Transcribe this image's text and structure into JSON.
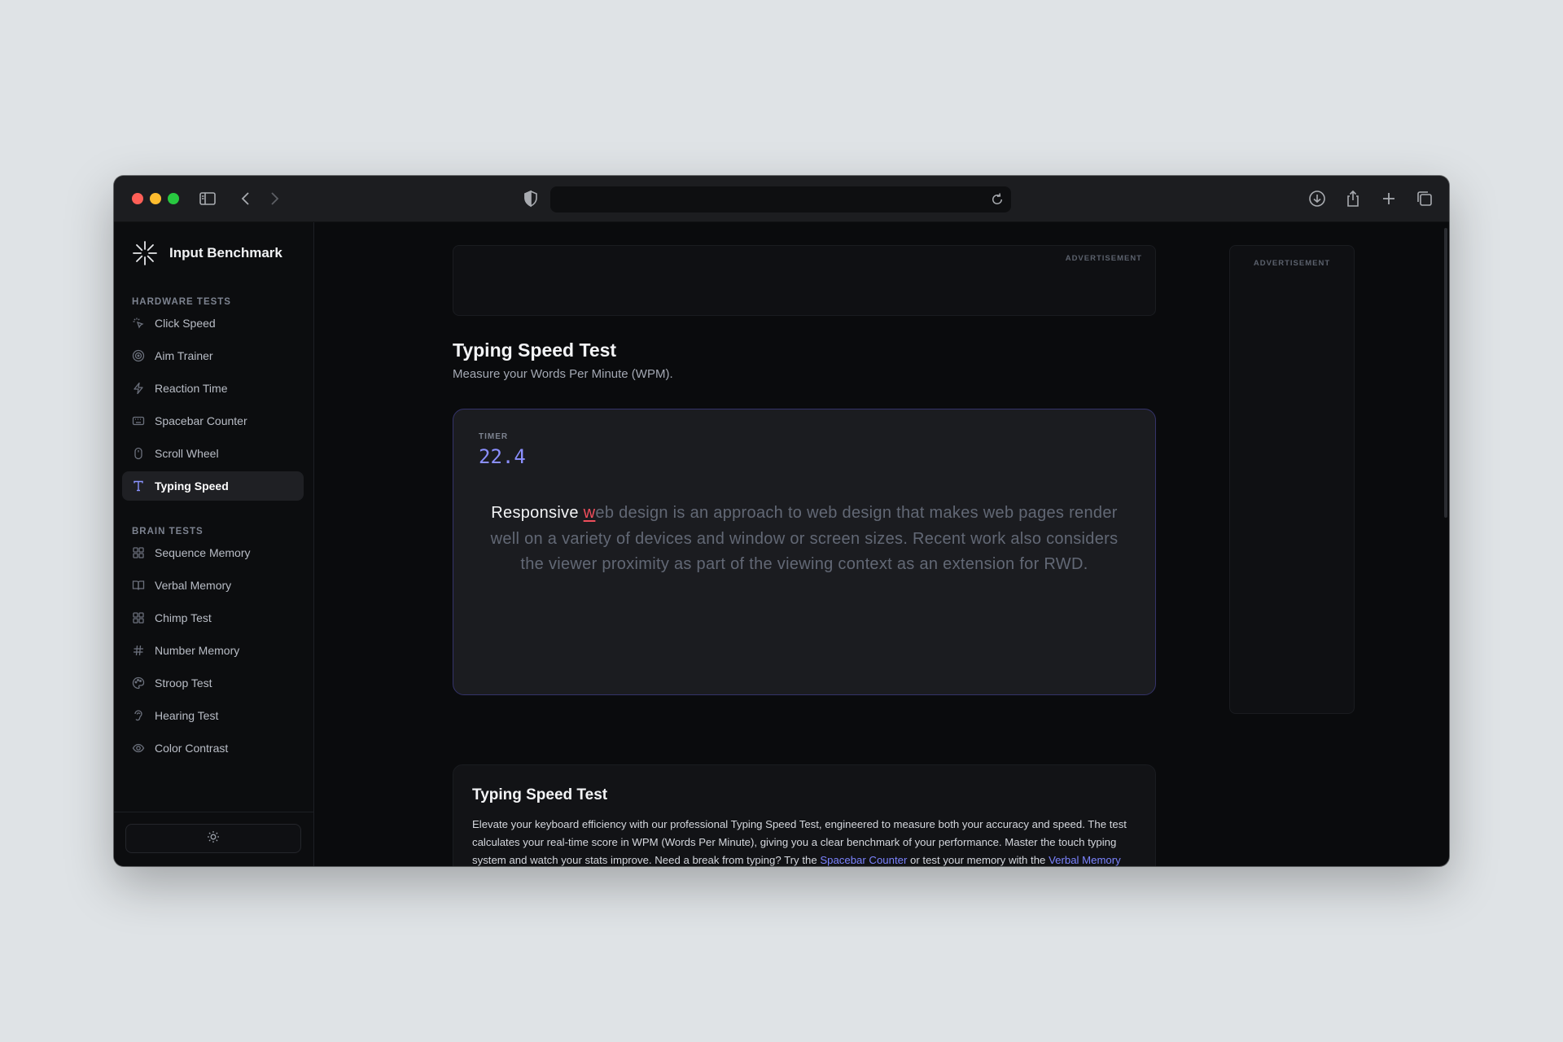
{
  "app": {
    "name": "Input Benchmark"
  },
  "sidebar": {
    "hardware_label": "HARDWARE TESTS",
    "hardware_items": [
      {
        "label": "Click Speed",
        "icon": "click-icon"
      },
      {
        "label": "Aim Trainer",
        "icon": "target-icon"
      },
      {
        "label": "Reaction Time",
        "icon": "lightning-icon"
      },
      {
        "label": "Spacebar Counter",
        "icon": "keyboard-icon"
      },
      {
        "label": "Scroll Wheel",
        "icon": "mouse-icon"
      },
      {
        "label": "Typing Speed",
        "icon": "type-icon",
        "active": true
      }
    ],
    "brain_label": "BRAIN TESTS",
    "brain_items": [
      {
        "label": "Sequence Memory",
        "icon": "grid-icon"
      },
      {
        "label": "Verbal Memory",
        "icon": "book-icon"
      },
      {
        "label": "Chimp Test",
        "icon": "grid-icon"
      },
      {
        "label": "Number Memory",
        "icon": "hash-icon"
      },
      {
        "label": "Stroop Test",
        "icon": "palette-icon"
      },
      {
        "label": "Hearing Test",
        "icon": "ear-icon"
      },
      {
        "label": "Color Contrast",
        "icon": "eye-icon"
      }
    ],
    "theme_icon": "sun-icon"
  },
  "ads": {
    "banner_label": "ADVERTISEMENT",
    "side_label": "ADVERTISEMENT"
  },
  "page": {
    "title": "Typing Speed Test",
    "subtitle": "Measure your Words Per Minute (WPM)."
  },
  "test": {
    "timer_label": "TIMER",
    "timer_value": "22.4",
    "typed_text": "Responsive ",
    "current_char": "w",
    "remaining_text": "eb design is an approach to web design that makes web pages render well on a variety of devices and window or screen sizes. Recent work also considers the viewer proximity as part of the viewing context as an extension for RWD."
  },
  "info": {
    "title": "Typing Speed Test",
    "text_before": "Elevate your keyboard efficiency with our professional Typing Speed Test, engineered to measure both your accuracy and speed. The test calculates your real-time score in WPM (Words Per Minute), giving you a clear benchmark of your performance. Master the touch typing system and watch your stats improve. Need a break from typing? Try the ",
    "link1": "Spacebar Counter",
    "text_middle": " or test your memory with the ",
    "link2": "Verbal Memory Test",
    "text_after": "."
  },
  "colors": {
    "accent": "#8b8fff",
    "error": "#ef4e5c",
    "link": "#7c84ff"
  }
}
